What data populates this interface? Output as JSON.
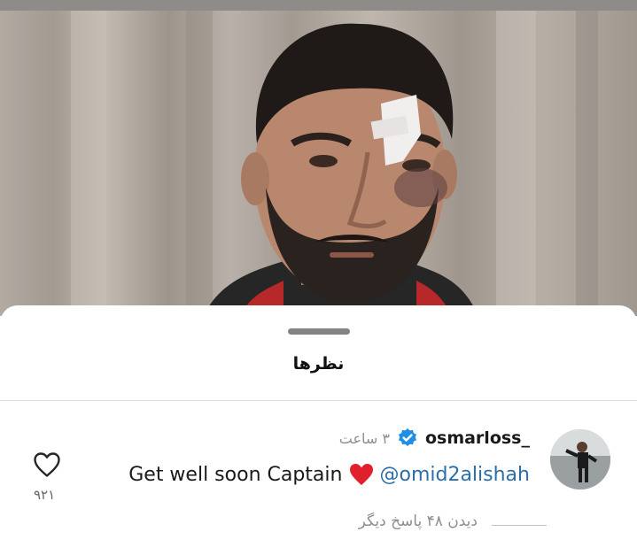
{
  "sheet": {
    "title": "نظرها"
  },
  "comment": {
    "username": "osmarloss_",
    "verified": true,
    "time": "۳ ساعت",
    "text_before_emoji": "Get well soon Captain",
    "emoji": "red-heart-emoji",
    "mention": "@omid2alishah",
    "like_count": "۹۲۱",
    "view_replies": "دیدن ۴۸ پاسخ دیگر"
  },
  "colors": {
    "mention": "#2b6ea8",
    "verified_badge": "#1f8fe6",
    "heart_emoji": "#e0202c",
    "muted_text": "#8e8e8e"
  }
}
